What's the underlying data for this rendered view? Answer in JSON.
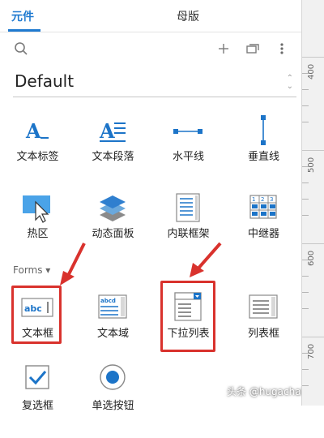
{
  "tabs": [
    {
      "label": "元件",
      "active": true
    },
    {
      "label": "母版",
      "active": false
    }
  ],
  "toolbar": {
    "search_icon": "search-icon",
    "add_icon": "plus-icon",
    "copy_icon": "duplicate-icon",
    "more_icon": "more-vertical-icon"
  },
  "library": {
    "selected": "Default"
  },
  "widgets_basic": [
    {
      "label": "文本标签",
      "icon": "text-label-icon"
    },
    {
      "label": "文本段落",
      "icon": "text-paragraph-icon"
    },
    {
      "label": "水平线",
      "icon": "horizontal-line-icon"
    },
    {
      "label": "垂直线",
      "icon": "vertical-line-icon"
    },
    {
      "label": "热区",
      "icon": "hotspot-icon"
    },
    {
      "label": "动态面板",
      "icon": "dynamic-panel-icon"
    },
    {
      "label": "内联框架",
      "icon": "inline-frame-icon"
    },
    {
      "label": "中继器",
      "icon": "repeater-icon"
    }
  ],
  "forms_section": {
    "label": "Forms ▾"
  },
  "widgets_forms": [
    {
      "label": "文本框",
      "icon": "text-field-icon",
      "field_text": "abc"
    },
    {
      "label": "文本域",
      "icon": "text-area-icon",
      "field_text": "abcd"
    },
    {
      "label": "下拉列表",
      "icon": "dropdown-list-icon"
    },
    {
      "label": "列表框",
      "icon": "list-box-icon"
    },
    {
      "label": "复选框",
      "icon": "checkbox-icon"
    },
    {
      "label": "单选按钮",
      "icon": "radio-button-icon"
    }
  ],
  "ruler": {
    "labels": [
      "400",
      "500",
      "600",
      "700"
    ]
  },
  "watermark": "头条 @hugachai928",
  "colors": {
    "accent": "#1f7ad0",
    "icon_blue": "#1c74c8",
    "highlight_red": "#d9322d"
  }
}
